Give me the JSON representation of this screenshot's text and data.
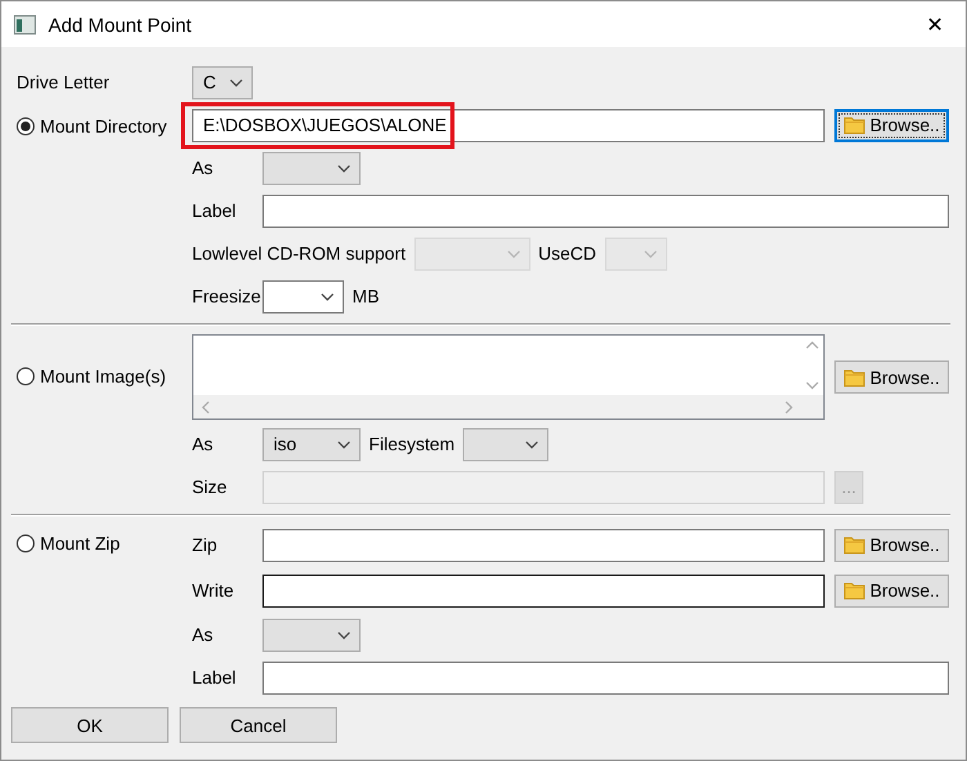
{
  "window": {
    "title": "Add Mount Point",
    "close": "✕"
  },
  "drive_letter": {
    "label": "Drive Letter",
    "combo": {
      "value": "C",
      "disabled": false
    }
  },
  "mount_directory": {
    "label": "Mount Directory",
    "selected": true,
    "path": {
      "value": "E:\\DOSBOX\\JUEGOS\\ALONE",
      "highlighted": true
    },
    "browse": {
      "label": "Browse..",
      "focused": true
    },
    "as": {
      "label": "As",
      "combo": {
        "disabled": false
      }
    },
    "label_field": {
      "label": "Label"
    },
    "lowlevel": {
      "label": "Lowlevel CD-ROM support",
      "combo": {
        "disabled": true
      }
    },
    "usecd": {
      "label": "UseCD",
      "combo": {
        "disabled": true
      }
    },
    "freesize": {
      "label": "Freesize",
      "combo": {
        "disabled": false,
        "editable": true
      },
      "unit": "MB"
    }
  },
  "mount_image": {
    "label": "Mount Image(s)",
    "selected": false,
    "browse": {
      "label": "Browse..",
      "focused": false
    },
    "as": {
      "label": "As",
      "combo": {
        "value": "iso",
        "disabled": false
      }
    },
    "filesystem": {
      "label": "Filesystem",
      "combo": {
        "disabled": false
      }
    },
    "size": {
      "label": "Size",
      "disabled": true,
      "button": {
        "label": "...",
        "disabled": true
      }
    }
  },
  "mount_zip": {
    "label": "Mount Zip",
    "selected": false,
    "zip": {
      "label": "Zip",
      "browse": {
        "label": "Browse..",
        "focused": false
      }
    },
    "write": {
      "label": "Write",
      "focused": true,
      "browse": {
        "label": "Browse..",
        "focused": false
      }
    },
    "as": {
      "label": "As",
      "combo": {
        "disabled": false
      }
    },
    "label_field": {
      "label": "Label"
    }
  },
  "buttons": [
    {
      "label": "OK"
    },
    {
      "label": "Cancel"
    }
  ]
}
